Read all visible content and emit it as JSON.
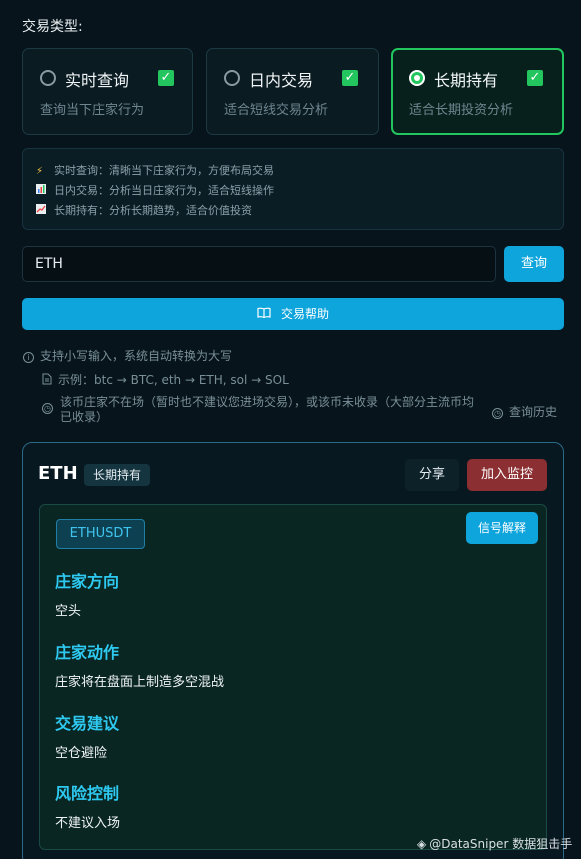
{
  "header": {
    "title": "交易类型:"
  },
  "trade_types": [
    {
      "title": "实时查询",
      "desc": "查询当下庄家行为",
      "selected": false,
      "checked": true
    },
    {
      "title": "日内交易",
      "desc": "适合短线交易分析",
      "selected": false,
      "checked": true
    },
    {
      "title": "长期持有",
      "desc": "适合长期投资分析",
      "selected": true,
      "checked": true
    }
  ],
  "tips": [
    {
      "icon": "lightning-icon",
      "text": "实时查询：清晰当下庄家行为，方便布局交易"
    },
    {
      "icon": "bar-chart-icon",
      "text": "日内交易：分析当日庄家行为，适合短线操作"
    },
    {
      "icon": "trend-chart-icon",
      "text": "长期持有：分析长期趋势，适合价值投资"
    }
  ],
  "search": {
    "value": "ETH",
    "button_label": "查询"
  },
  "help": {
    "label": "交易帮助"
  },
  "notes": {
    "lowercase": "支持小写输入，系统自动转换为大写",
    "example": "示例：btc → BTC, eth → ETH, sol → SOL",
    "warning_line1": "该币庄家不在场（暂时也不建议您进场交易），或该币未收录（大部分主流币均",
    "warning_line2": "已收录）",
    "history": "查询历史"
  },
  "result": {
    "symbol": "ETH",
    "mode_tag": "长期持有",
    "share_label": "分享",
    "monitor_label": "加入监控",
    "pair": "ETHUSDT",
    "signal_label": "信号解释",
    "sections": [
      {
        "title": "庄家方向",
        "value": "空头"
      },
      {
        "title": "庄家动作",
        "value": "庄家将在盘面上制造多空混战"
      },
      {
        "title": "交易建议",
        "value": "空仓避险"
      },
      {
        "title": "风险控制",
        "value": "不建议入场"
      }
    ]
  },
  "watermark": "@DataSniper 数据狙击手",
  "colors": {
    "accent": "#0ea5dc",
    "success": "#22c55e",
    "danger": "#8b2f32",
    "section_title": "#2ec9f0"
  }
}
